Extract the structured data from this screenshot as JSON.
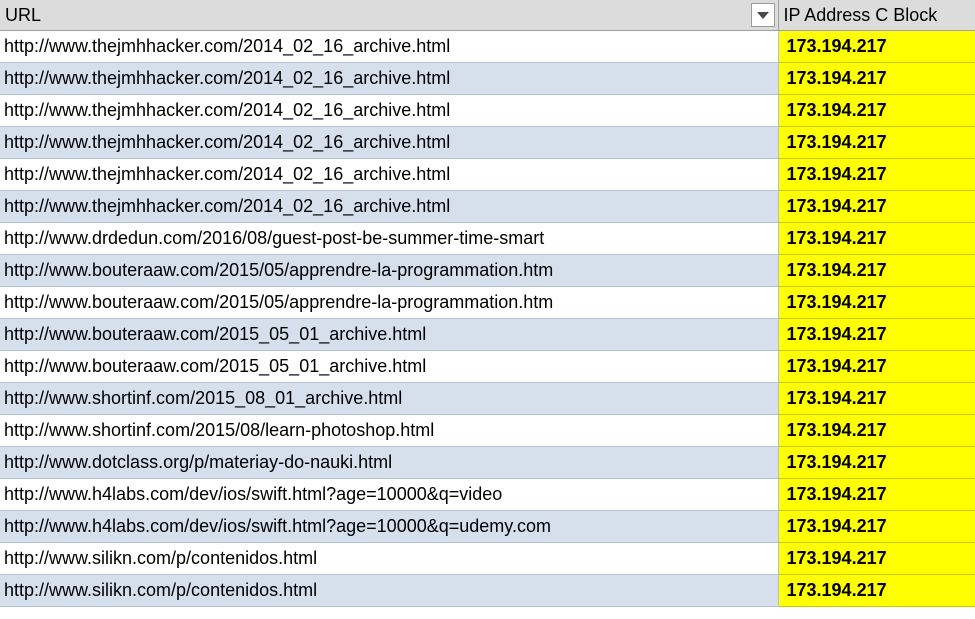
{
  "header": {
    "url_column": "URL",
    "ip_column": "IP Address C Block",
    "filter_icon": "chevron-down-icon"
  },
  "columns": [
    "URL",
    "IP Address C Block"
  ],
  "rows": [
    {
      "url": "http://www.thejmhhacker.com/2014_02_16_archive.html",
      "ip": "173.194.217"
    },
    {
      "url": "http://www.thejmhhacker.com/2014_02_16_archive.html",
      "ip": "173.194.217"
    },
    {
      "url": "http://www.thejmhhacker.com/2014_02_16_archive.html",
      "ip": "173.194.217"
    },
    {
      "url": "http://www.thejmhhacker.com/2014_02_16_archive.html",
      "ip": "173.194.217"
    },
    {
      "url": "http://www.thejmhhacker.com/2014_02_16_archive.html",
      "ip": "173.194.217"
    },
    {
      "url": "http://www.thejmhhacker.com/2014_02_16_archive.html",
      "ip": "173.194.217"
    },
    {
      "url": "http://www.drdedun.com/2016/08/guest-post-be-summer-time-smart",
      "ip": "173.194.217"
    },
    {
      "url": "http://www.bouteraaw.com/2015/05/apprendre-la-programmation.htm",
      "ip": "173.194.217"
    },
    {
      "url": "http://www.bouteraaw.com/2015/05/apprendre-la-programmation.htm",
      "ip": "173.194.217"
    },
    {
      "url": "http://www.bouteraaw.com/2015_05_01_archive.html",
      "ip": "173.194.217"
    },
    {
      "url": "http://www.bouteraaw.com/2015_05_01_archive.html",
      "ip": "173.194.217"
    },
    {
      "url": "http://www.shortinf.com/2015_08_01_archive.html",
      "ip": "173.194.217"
    },
    {
      "url": "http://www.shortinf.com/2015/08/learn-photoshop.html",
      "ip": "173.194.217"
    },
    {
      "url": "http://www.dotclass.org/p/materiay-do-nauki.html",
      "ip": "173.194.217"
    },
    {
      "url": "http://www.h4labs.com/dev/ios/swift.html?age=10000&q=video",
      "ip": "173.194.217"
    },
    {
      "url": "http://www.h4labs.com/dev/ios/swift.html?age=10000&q=udemy.com",
      "ip": "173.194.217"
    },
    {
      "url": "http://www.silikn.com/p/contenidos.html",
      "ip": "173.194.217"
    },
    {
      "url": "http://www.silikn.com/p/contenidos.html",
      "ip": "173.194.217"
    }
  ],
  "colors": {
    "header_bg": "#dcdcdc",
    "row_alt_bg": "#d6dfec",
    "ip_highlight_bg": "#ffff00",
    "grid_line": "#b4c0d4"
  }
}
